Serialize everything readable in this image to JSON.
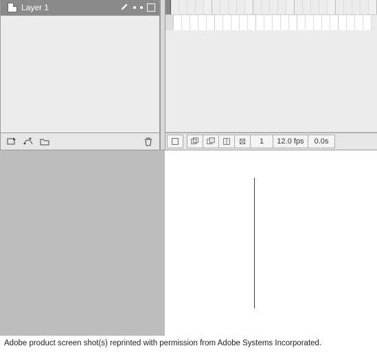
{
  "layers": {
    "row": {
      "name": "Layer 1"
    },
    "footer": {
      "insert_layer": "insert-layer",
      "insert_motion": "add-motion-guide",
      "insert_folder": "insert-folder",
      "delete": "delete-layer"
    }
  },
  "timeline": {
    "footer": {
      "current_frame": "1",
      "fps": "12.0 fps",
      "elapsed": "0.0s"
    }
  },
  "caption": "Adobe product screen shot(s) reprinted with permission from Adobe Systems Incorporated."
}
